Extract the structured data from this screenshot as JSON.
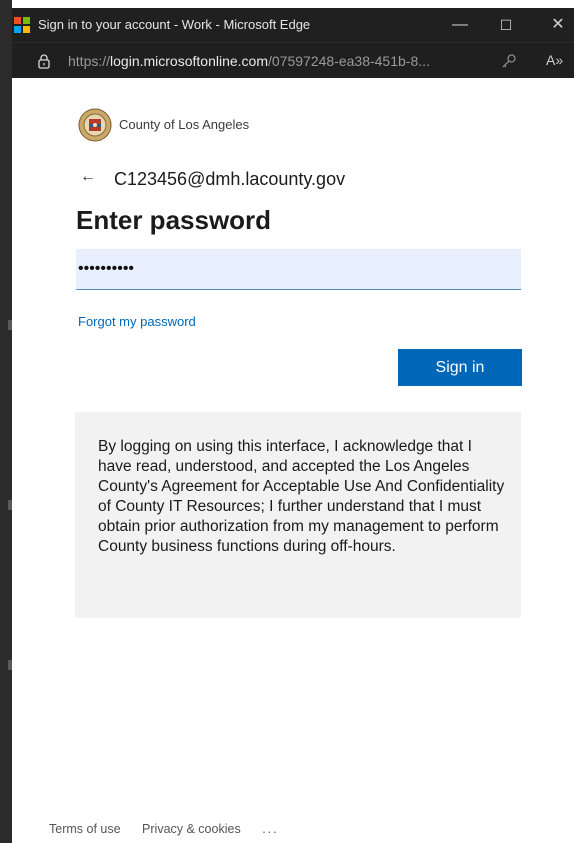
{
  "window": {
    "title": "Sign in to your account - Work - Microsoft Edge",
    "controls": {
      "minimize": "—",
      "maximize": "☐",
      "close": "✕"
    }
  },
  "address_bar": {
    "scheme": "https://",
    "host": "login.microsoftonline.com",
    "path": "/07597248-ea38-451b-8...",
    "read_aloud": "A»"
  },
  "page": {
    "org_name": "County of Los Angeles",
    "back_arrow": "←",
    "identity": "C123456@dmh.lacounty.gov",
    "heading": "Enter password",
    "password_value": "••••••••••",
    "forgot_link": "Forgot my password",
    "signin_button": "Sign in",
    "notice": "By logging on using this interface, I acknowledge that I have read, understood, and accepted the Los Angeles County's Agreement for Acceptable Use And Confidentiality of County IT Resources; I further understand that I must obtain prior authorization from my management to perform County business functions during off-hours."
  },
  "footer": {
    "terms": "Terms of use",
    "privacy": "Privacy & cookies",
    "more": "..."
  },
  "colors": {
    "accent": "#0067b8",
    "titlebar": "#202020",
    "input_bg": "#e8f0fe",
    "notice_bg": "#f2f2f2"
  }
}
